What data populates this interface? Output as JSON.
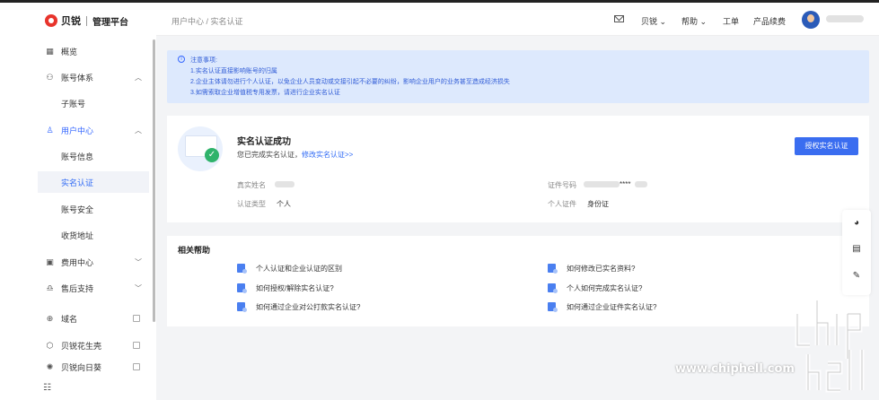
{
  "brand": {
    "name": "贝锐",
    "subtitle": "管理平台"
  },
  "header": {
    "breadcrumb": "用户中心 / 实名认证",
    "menu_brand": "贝锐",
    "menu_help": "帮助",
    "menu_ticket": "工单",
    "menu_renew": "产品续费"
  },
  "sidebar": {
    "overview": "概览",
    "account_system": "账号体系",
    "sub_account": "子账号",
    "user_center": "用户中心",
    "account_info": "账号信息",
    "real_name": "实名认证",
    "account_security": "账号安全",
    "shipping_address": "收货地址",
    "billing_center": "费用中心",
    "after_sales": "售后支持",
    "domain": "域名",
    "peanut_shell": "贝锐花生壳",
    "more": "贝锐向日葵"
  },
  "notice": {
    "title": "注意事项:",
    "lines": [
      "1.实名认证直接影响账号的归属",
      "2.企业主体请勿进行个人认证，以免企业人员变动或交接引起不必要的纠纷，影响企业用户的业务甚至造成经济损失",
      "3.如需索取企业增值税专用发票，请进行企业实名认证"
    ]
  },
  "verify": {
    "title": "实名认证成功",
    "desc": "您已完成实名认证，",
    "modify_link": "修改实名认证>>",
    "authorize_button": "授权实名认证",
    "name_label": "真实姓名",
    "id_label": "证件号码",
    "id_masked": "****",
    "type_label": "认证类型",
    "type_value": "个人",
    "cert_label": "个人证件",
    "cert_value": "身份证"
  },
  "help": {
    "title": "相关帮助",
    "items": [
      "个人认证和企业认证的区别",
      "如何修改已实名资料?",
      "如何授权/解除实名认证?",
      "个人如何完成实名认证?",
      "如何通过企业对公打款实名认证?",
      "如何通过企业证件实名认证?"
    ]
  },
  "watermark": {
    "site": "www.chiphell.com"
  },
  "colors": {
    "primary": "#3a6df0",
    "notice_bg": "#dde9fd",
    "success": "#2fb36b",
    "brand_red": "#e8342c"
  }
}
